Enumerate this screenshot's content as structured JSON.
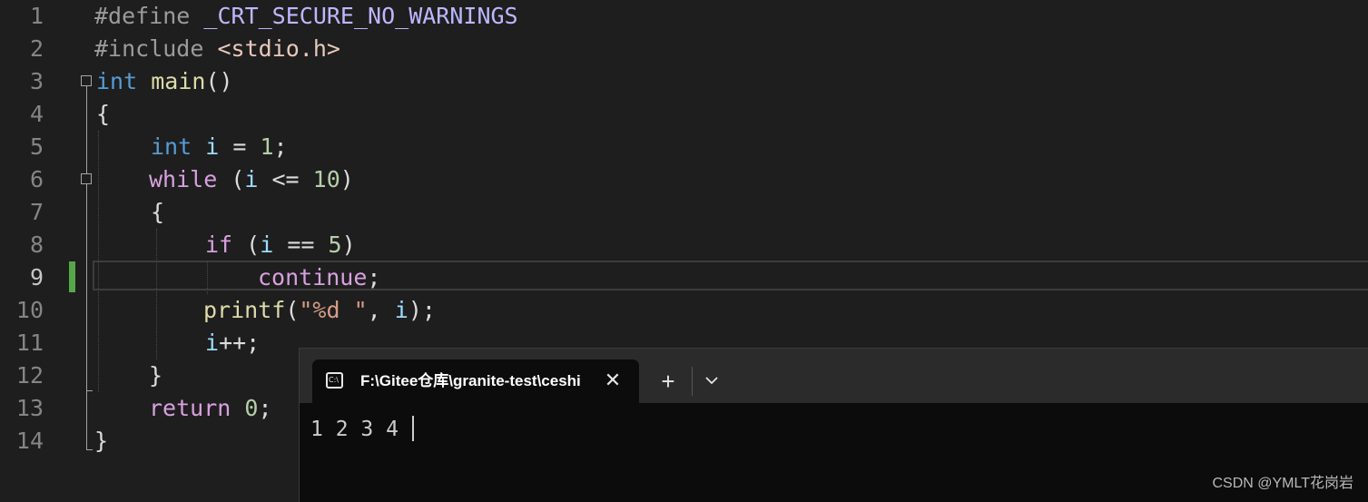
{
  "editor": {
    "lines": [
      {
        "num": "1"
      },
      {
        "num": "2"
      },
      {
        "num": "3"
      },
      {
        "num": "4"
      },
      {
        "num": "5"
      },
      {
        "num": "6"
      },
      {
        "num": "7"
      },
      {
        "num": "8"
      },
      {
        "num": "9"
      },
      {
        "num": "10"
      },
      {
        "num": "11"
      },
      {
        "num": "12"
      },
      {
        "num": "13"
      },
      {
        "num": "14"
      }
    ],
    "tokens": {
      "l1_pp": "#define",
      "l1_macro": "_CRT_SECURE_NO_WARNINGS",
      "l2_pp": "#include",
      "l2_header": "<stdio.h>",
      "l3_type": "int",
      "l3_fn": "main",
      "l3_parens": "()",
      "l4_brace": "{",
      "l5_type": "int",
      "l5_var": "i",
      "l5_op": " = ",
      "l5_num": "1",
      "l5_semi": ";",
      "l6_kw": "while",
      "l6_open": " (",
      "l6_var": "i",
      "l6_op": " <= ",
      "l6_num": "10",
      "l6_close": ")",
      "l7_brace": "{",
      "l8_kw": "if",
      "l8_open": " (",
      "l8_var": "i",
      "l8_op": " == ",
      "l8_num": "5",
      "l8_close": ")",
      "l9_kw": "continue",
      "l9_semi": ";",
      "l10_fn": "printf",
      "l10_open": "(",
      "l10_str": "\"%d \"",
      "l10_comma": ", ",
      "l10_var": "i",
      "l10_close": ");",
      "l11_var": "i",
      "l11_op": "++;",
      "l12_brace": "}",
      "l13_kw": "return",
      "l13_num": "0",
      "l13_semi": ";",
      "l14_brace": "}"
    },
    "fold_glyph": "⊟",
    "change_color": "#57a64a"
  },
  "terminal": {
    "tab_title": "F:\\Gitee仓库\\granite-test\\ceshi",
    "tab_icon": "C:\\",
    "close_glyph": "✕",
    "new_tab_glyph": "+",
    "output": "1 2 3 4"
  },
  "watermark": "CSDN @YMLT花岗岩"
}
